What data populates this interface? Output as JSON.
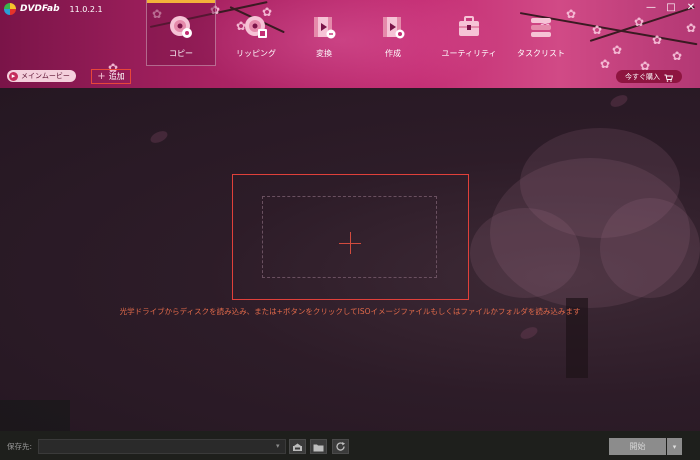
{
  "app": {
    "logo_text": "DVDFab",
    "version": "11.0.2.1"
  },
  "window_controls": {
    "minimize": "—",
    "maximize": "□",
    "close": "✕"
  },
  "nav": {
    "active": "copy",
    "tabs": [
      {
        "id": "copy",
        "label": "コピー",
        "icon": "copy-disc-icon"
      },
      {
        "id": "ripping",
        "label": "リッピング",
        "icon": "ripping-disc-icon"
      },
      {
        "id": "convert",
        "label": "変換",
        "icon": "convert-film-icon"
      },
      {
        "id": "create",
        "label": "作成",
        "icon": "create-film-icon"
      },
      {
        "id": "utility",
        "label": "ユーティリティ",
        "icon": "utility-toolbox-icon"
      },
      {
        "id": "tasklist",
        "label": "タスクリスト",
        "icon": "tasklist-icon"
      }
    ]
  },
  "subbar": {
    "main_movie": "メインムービー",
    "add": "追加",
    "buy_now": "今すぐ購入"
  },
  "main": {
    "instruction": "光学ドライブからディスクを読み込み、または+ボタンをクリックしてISOイメージファイルもしくはファイルかフォルダを読み込みます"
  },
  "bottom": {
    "save_label": "保存先:",
    "save_value": "",
    "start": "開始"
  },
  "colors": {
    "accent_red": "#e0403a",
    "header_pink": "#c42e74",
    "active_tab_marker": "#f2b23a"
  }
}
